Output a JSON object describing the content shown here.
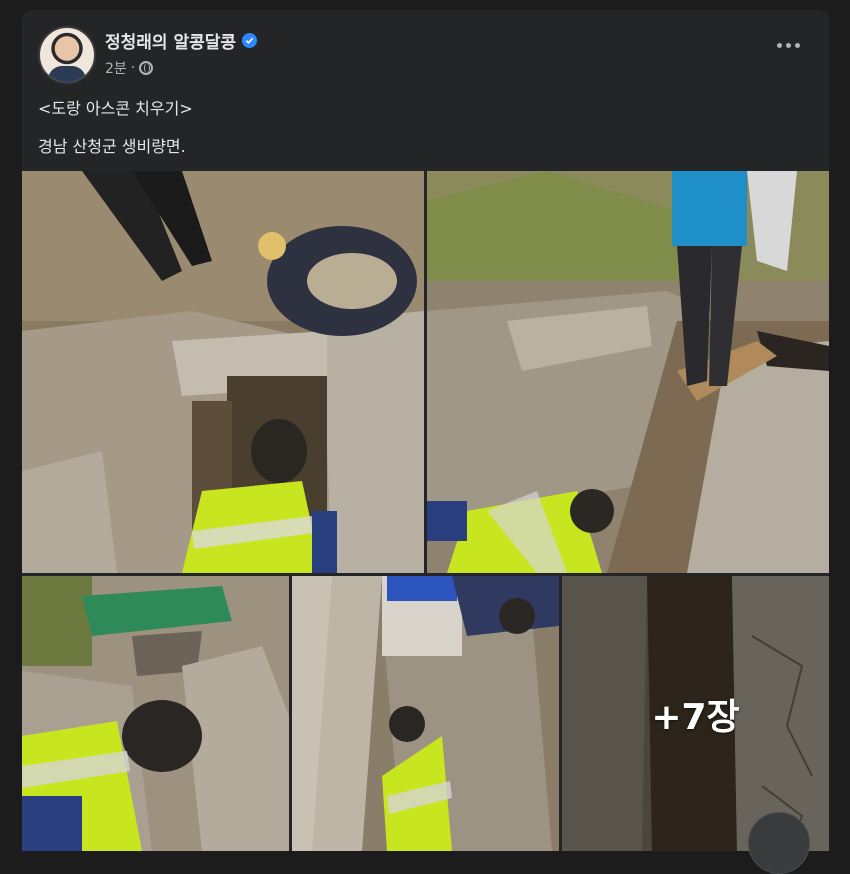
{
  "post": {
    "author": "정청래의 알콩달콩",
    "time": "2분",
    "separator": "·",
    "text_line1": "<도랑 아스콘 치우기>",
    "text_line2": "경남 산청군 생비량면."
  },
  "gallery": {
    "more_count": "+7장"
  },
  "colors": {
    "background": "#1c1c1d",
    "card": "#242526",
    "text_primary": "#e4e6eb",
    "text_secondary": "#b0b3b8",
    "verified_badge": "#2d88ff",
    "safety_vest": "#c8e620"
  },
  "icons": {
    "verified": "verified-badge-icon",
    "privacy": "globe-icon",
    "menu": "more-options-icon"
  }
}
